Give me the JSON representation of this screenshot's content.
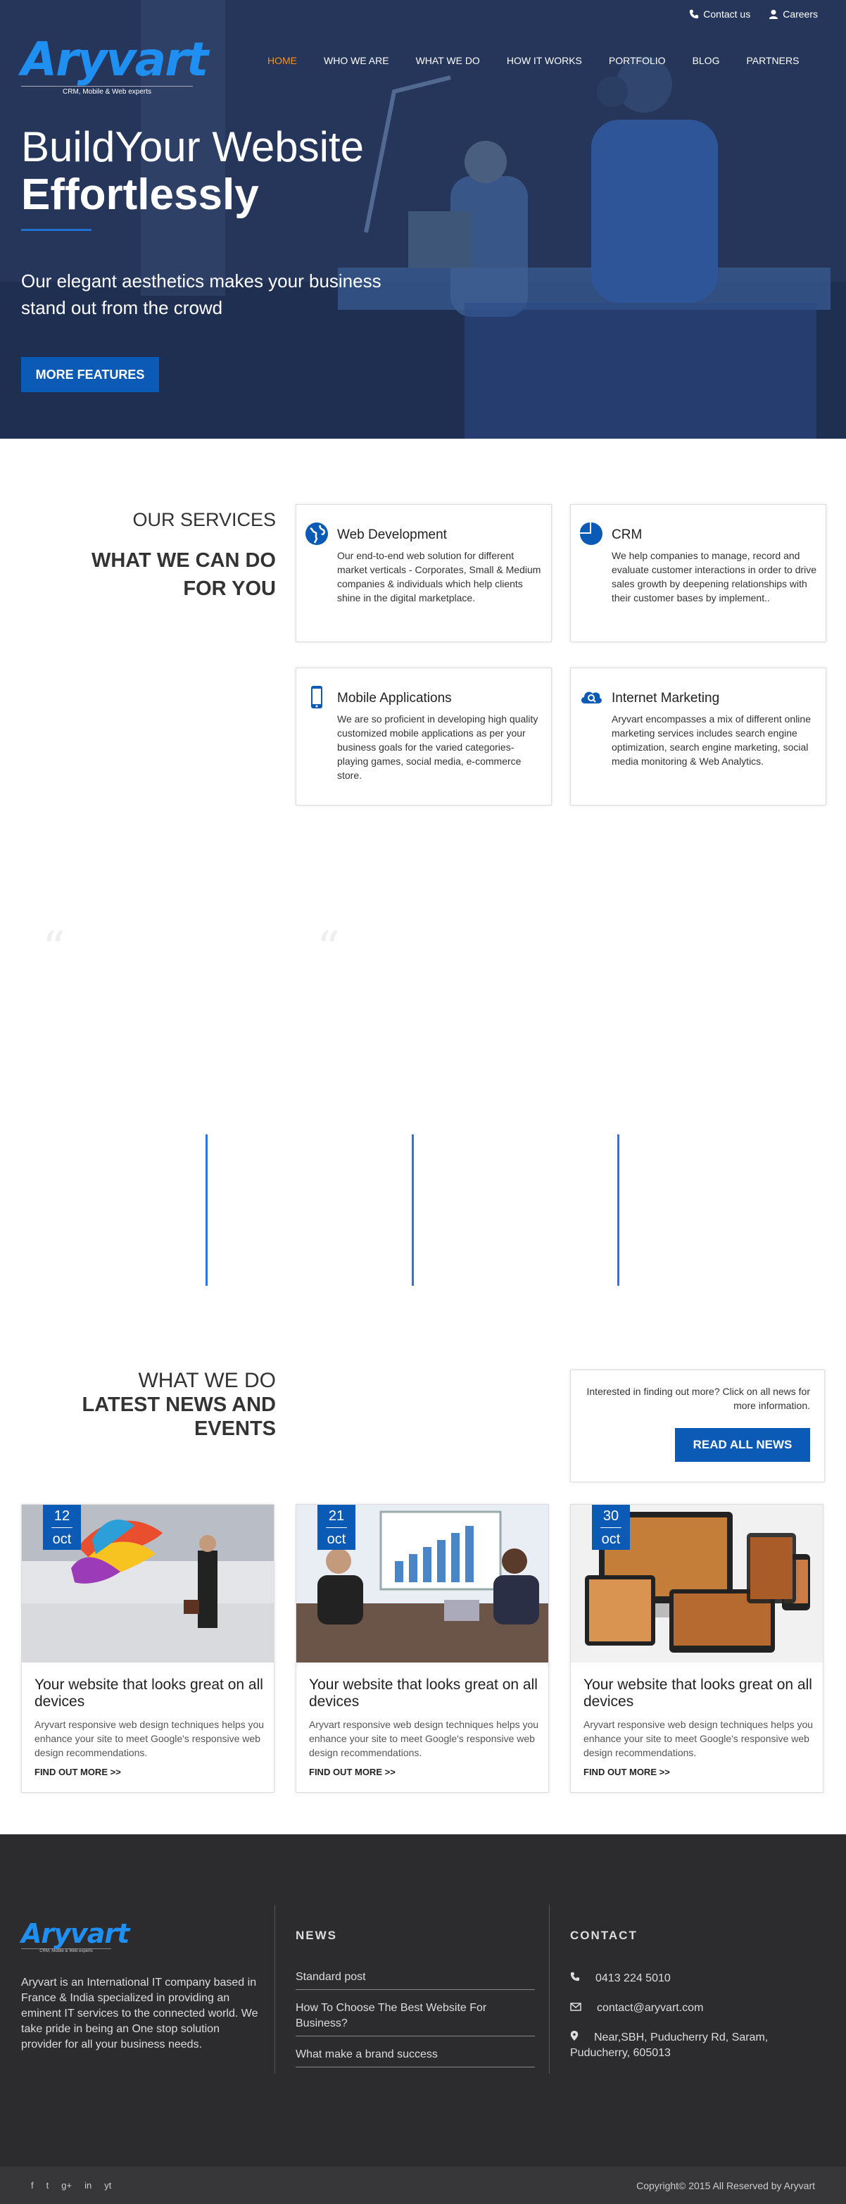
{
  "topbar": {
    "contact": "Contact us",
    "careers": "Careers"
  },
  "brand": {
    "name": "Aryvart",
    "tagline": "CRM, Mobile & Web experts"
  },
  "nav": [
    "HOME",
    "WHO WE ARE",
    "WHAT WE DO",
    "HOW IT WORKS",
    "PORTFOLIO",
    "BLOG",
    "PARTNERS"
  ],
  "hero": {
    "line1": "BuildYour Website",
    "line2": "Effortlessly",
    "subtitle": "Our elegant aesthetics makes your business stand out from the crowd",
    "button": "MORE FEATURES"
  },
  "services": {
    "kicker": "OUR SERVICES",
    "title": "WHAT WE CAN DO FOR YOU",
    "items": [
      {
        "title": "Web Development",
        "icon": "globe-icon",
        "text": "Our end-to-end web solution for different market verticals - Corporates, Small & Medium companies & individuals which help clients shine in the digital marketplace."
      },
      {
        "title": "CRM",
        "icon": "pie-chart-icon",
        "text": "We help companies to manage, record and evaluate customer interactions in order to drive sales growth by deepening relationships with their customer bases by implement.."
      },
      {
        "title": "Mobile Applications",
        "icon": "mobile-icon",
        "text": "We are so proficient in developing high quality customized mobile applications as per your business goals for the varied categories-playing games, social media, e-commerce store."
      },
      {
        "title": "Internet Marketing",
        "icon": "cloud-search-icon",
        "text": "Aryvart encompasses a mix of different online marketing services includes search engine optimization, search engine marketing, social media monitoring & Web Analytics."
      }
    ]
  },
  "news": {
    "kicker": "WHAT WE DO",
    "title": "LATEST NEWS AND EVENTS",
    "box_text": "Interested in finding out more? Click on all news for more information.",
    "box_button": "READ ALL NEWS",
    "posts": [
      {
        "day": "12",
        "month": "oct",
        "title": "Your website that looks great on all devices",
        "text": "Aryvart responsive web design techniques helps you enhance your site to meet Google's responsive web design recommendations.",
        "link": "FIND OUT MORE >>"
      },
      {
        "day": "21",
        "month": "oct",
        "title": "Your website that looks great on all devices",
        "text": "Aryvart responsive web design techniques helps you enhance your site to meet Google's responsive web design recommendations.",
        "link": "FIND OUT MORE >>"
      },
      {
        "day": "30",
        "month": "oct",
        "title": "Your website that looks great on all devices",
        "text": "Aryvart responsive web design techniques helps you enhance your site to meet Google's responsive web design recommendations.",
        "link": "FIND OUT MORE >>"
      }
    ]
  },
  "footer": {
    "about": "Aryvart is an International IT company based in France & India specialized in providing an eminent IT services to the connected world. We take pride in being an One stop solution provider for all your business needs.",
    "news_heading": "NEWS",
    "news_links": [
      "Standard post",
      "How To Choose The Best Website For Business?",
      "What make a brand success"
    ],
    "contact_heading": "CONTACT",
    "phone": "0413 224 5010",
    "email": "contact@aryvart.com",
    "address": "Near,SBH, Puducherry Rd, Saram, Puducherry, 605013",
    "copyright": "Copyright© 2015 All Reserved by Aryvart",
    "social": [
      "f",
      "t",
      "g+",
      "in",
      "yt"
    ]
  },
  "colors": {
    "accent": "#0b5ab5",
    "brand": "#1f8ff2",
    "active_nav": "#f7941d",
    "footer_bg": "#2c2c2e"
  }
}
